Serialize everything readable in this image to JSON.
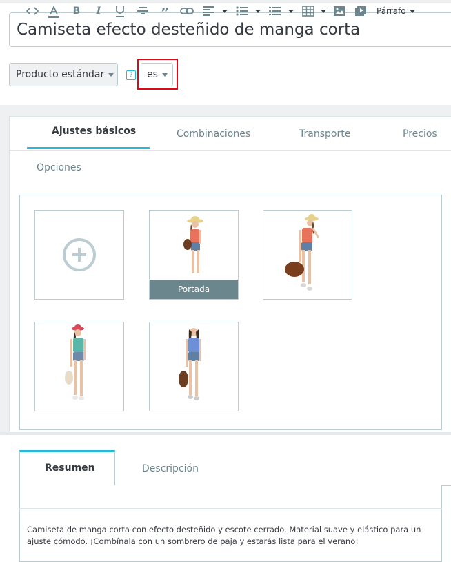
{
  "product": {
    "name": "Camiseta efecto desteñido de manga corta",
    "type_selector": "Producto estándar",
    "language_selector": "es",
    "help_icon_label": "?"
  },
  "main_tabs": [
    {
      "label": "Ajustes básicos",
      "active": true
    },
    {
      "label": "Combinaciones",
      "active": false
    },
    {
      "label": "Transporte",
      "active": false
    },
    {
      "label": "Precios",
      "active": false
    },
    {
      "label": "Opciones",
      "active": false
    }
  ],
  "images": {
    "add_icon": "plus-circle-icon",
    "cover_label": "Portada",
    "items": [
      {
        "shirt_color": "#e8735c",
        "hat_color": "#e8d28a",
        "bag": "shoulder"
      },
      {
        "shirt_color": "#e8735c",
        "hat_color": "#e8d28a",
        "bag": "hand"
      },
      {
        "shirt_color": "#59b6a8",
        "hat_color": "#d94b5a",
        "bag": "hand-light"
      },
      {
        "shirt_color": "#6c8fd8",
        "hat_color": "",
        "bag": "shoulder"
      }
    ]
  },
  "description_tabs": [
    {
      "label": "Resumen",
      "active": true
    },
    {
      "label": "Descripción",
      "active": false
    }
  ],
  "editor": {
    "toolbar_icons": [
      "code-icon",
      "font-color-icon",
      "bold-icon",
      "italic-icon",
      "underline-icon",
      "strikethrough-icon",
      "quote-icon",
      "link-icon",
      "align-icon",
      "bullet-list-icon",
      "numbered-list-icon",
      "table-icon",
      "image-icon",
      "media-icon"
    ],
    "format_label": "Párrafo",
    "content": "Camiseta de manga corta con efecto desteñido y escote cerrado. Material suave y elástico para un ajuste cómodo. ¡Combínala con un sombrero de paja y estarás lista para el verano!"
  },
  "colors": {
    "accent": "#25b9d7",
    "highlight_border": "#e30613",
    "cover_bg": "#6c868e"
  }
}
